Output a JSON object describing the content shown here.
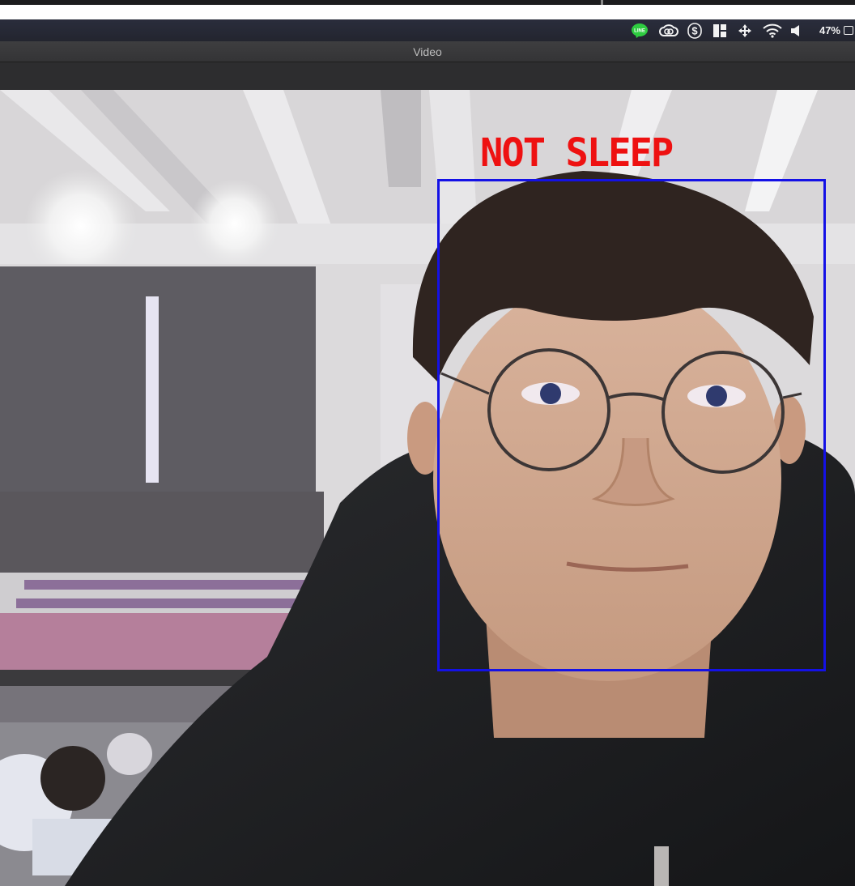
{
  "menubar": {
    "status_icons": [
      "line-app-icon",
      "creative-cloud-icon",
      "dollar-app-icon",
      "window-layout-icon",
      "move-arrows-icon",
      "wifi-icon",
      "volume-icon",
      "battery-icon"
    ],
    "battery_percent": "47%"
  },
  "window": {
    "title": "Video"
  },
  "video": {
    "detection_label": "NOT SLEEP",
    "label_color": "#ee1111",
    "box_color": "#1411e6"
  }
}
